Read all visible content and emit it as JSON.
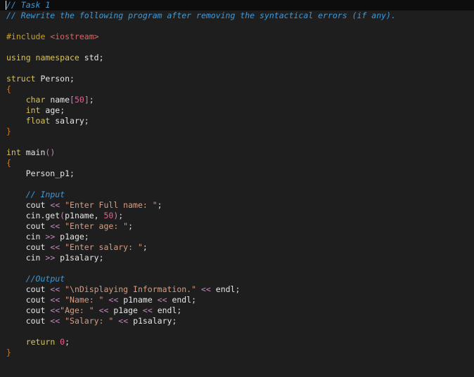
{
  "colors": {
    "background": "#1e1e1e",
    "comment": "#3c9adc",
    "keyword": "#d9c45a",
    "string": "#d69d85",
    "number": "#e65f8f",
    "operator": "#c586c0",
    "brace": "#c57b2f"
  },
  "lines": [
    {
      "tokens": [
        {
          "t": "comment",
          "v": "// Task 1"
        }
      ]
    },
    {
      "tokens": [
        {
          "t": "comment",
          "v": "// Rewrite the following program after removing the syntactical errors (if any)."
        }
      ]
    },
    {
      "tokens": []
    },
    {
      "tokens": [
        {
          "t": "directive",
          "v": "#include "
        },
        {
          "t": "header",
          "v": "<iostream>"
        }
      ]
    },
    {
      "tokens": []
    },
    {
      "tokens": [
        {
          "t": "kw",
          "v": "using namespace "
        },
        {
          "t": "txt",
          "v": "std"
        },
        {
          "t": "punc",
          "v": ";"
        }
      ]
    },
    {
      "tokens": []
    },
    {
      "tokens": [
        {
          "t": "kw",
          "v": "struct "
        },
        {
          "t": "txt",
          "v": "Person"
        },
        {
          "t": "punc",
          "v": ";"
        }
      ]
    },
    {
      "tokens": [
        {
          "t": "brace",
          "v": "{"
        }
      ]
    },
    {
      "tokens": [
        {
          "t": "txt",
          "v": "    "
        },
        {
          "t": "type",
          "v": "char "
        },
        {
          "t": "txt",
          "v": "name"
        },
        {
          "t": "bracket",
          "v": "["
        },
        {
          "t": "num",
          "v": "50"
        },
        {
          "t": "bracket",
          "v": "]"
        },
        {
          "t": "punc",
          "v": ";"
        }
      ]
    },
    {
      "tokens": [
        {
          "t": "txt",
          "v": "    "
        },
        {
          "t": "type",
          "v": "int "
        },
        {
          "t": "txt",
          "v": "age"
        },
        {
          "t": "punc",
          "v": ";"
        }
      ]
    },
    {
      "tokens": [
        {
          "t": "txt",
          "v": "    "
        },
        {
          "t": "type",
          "v": "float "
        },
        {
          "t": "txt",
          "v": "salary"
        },
        {
          "t": "punc",
          "v": ";"
        }
      ]
    },
    {
      "tokens": [
        {
          "t": "brace",
          "v": "}"
        }
      ]
    },
    {
      "tokens": []
    },
    {
      "tokens": [
        {
          "t": "type",
          "v": "int "
        },
        {
          "t": "txt",
          "v": "main"
        },
        {
          "t": "paren",
          "v": "()"
        }
      ]
    },
    {
      "tokens": [
        {
          "t": "brace",
          "v": "{"
        }
      ]
    },
    {
      "tokens": [
        {
          "t": "txt",
          "v": "    Person_p1"
        },
        {
          "t": "punc",
          "v": ";"
        }
      ]
    },
    {
      "tokens": []
    },
    {
      "tokens": [
        {
          "t": "txt",
          "v": "    "
        },
        {
          "t": "comment",
          "v": "// Input"
        }
      ]
    },
    {
      "tokens": [
        {
          "t": "txt",
          "v": "    cout "
        },
        {
          "t": "op",
          "v": "<<"
        },
        {
          "t": "str",
          "v": " \"Enter Full name: \""
        },
        {
          "t": "punc",
          "v": ";"
        }
      ]
    },
    {
      "tokens": [
        {
          "t": "txt",
          "v": "    cin.get"
        },
        {
          "t": "paren",
          "v": "("
        },
        {
          "t": "txt",
          "v": "p1name, "
        },
        {
          "t": "num",
          "v": "50"
        },
        {
          "t": "paren",
          "v": ")"
        },
        {
          "t": "punc",
          "v": ";"
        }
      ]
    },
    {
      "tokens": [
        {
          "t": "txt",
          "v": "    cout "
        },
        {
          "t": "op",
          "v": "<<"
        },
        {
          "t": "str",
          "v": " \"Enter age: \""
        },
        {
          "t": "punc",
          "v": ";"
        }
      ]
    },
    {
      "tokens": [
        {
          "t": "txt",
          "v": "    cin "
        },
        {
          "t": "op",
          "v": ">>"
        },
        {
          "t": "txt",
          "v": " p1age"
        },
        {
          "t": "punc",
          "v": ";"
        }
      ]
    },
    {
      "tokens": [
        {
          "t": "txt",
          "v": "    cout "
        },
        {
          "t": "op",
          "v": "<<"
        },
        {
          "t": "str",
          "v": " \"Enter salary: \""
        },
        {
          "t": "punc",
          "v": ";"
        }
      ]
    },
    {
      "tokens": [
        {
          "t": "txt",
          "v": "    cin "
        },
        {
          "t": "op",
          "v": ">>"
        },
        {
          "t": "txt",
          "v": " p1salary"
        },
        {
          "t": "punc",
          "v": ";"
        }
      ]
    },
    {
      "tokens": []
    },
    {
      "tokens": [
        {
          "t": "txt",
          "v": "    "
        },
        {
          "t": "comment",
          "v": "//Output"
        }
      ]
    },
    {
      "tokens": [
        {
          "t": "txt",
          "v": "    cout "
        },
        {
          "t": "op",
          "v": "<<"
        },
        {
          "t": "str",
          "v": " \"\\nDisplaying Information.\""
        },
        {
          "t": "txt",
          "v": " "
        },
        {
          "t": "op",
          "v": "<<"
        },
        {
          "t": "txt",
          "v": " endl"
        },
        {
          "t": "punc",
          "v": ";"
        }
      ]
    },
    {
      "tokens": [
        {
          "t": "txt",
          "v": "    cout "
        },
        {
          "t": "op",
          "v": "<<"
        },
        {
          "t": "str",
          "v": " \"Name: \""
        },
        {
          "t": "txt",
          "v": " "
        },
        {
          "t": "op",
          "v": "<<"
        },
        {
          "t": "txt",
          "v": " p1name "
        },
        {
          "t": "op",
          "v": "<<"
        },
        {
          "t": "txt",
          "v": " endl"
        },
        {
          "t": "punc",
          "v": ";"
        }
      ]
    },
    {
      "tokens": [
        {
          "t": "txt",
          "v": "    cout "
        },
        {
          "t": "op",
          "v": "<<"
        },
        {
          "t": "str",
          "v": "\"Age: \""
        },
        {
          "t": "txt",
          "v": " "
        },
        {
          "t": "op",
          "v": "<<"
        },
        {
          "t": "txt",
          "v": " p1age "
        },
        {
          "t": "op",
          "v": "<<"
        },
        {
          "t": "txt",
          "v": " endl"
        },
        {
          "t": "punc",
          "v": ";"
        }
      ]
    },
    {
      "tokens": [
        {
          "t": "txt",
          "v": "    cout "
        },
        {
          "t": "op",
          "v": "<<"
        },
        {
          "t": "str",
          "v": " \"Salary: \""
        },
        {
          "t": "txt",
          "v": " "
        },
        {
          "t": "op",
          "v": "<<"
        },
        {
          "t": "txt",
          "v": " p1salary"
        },
        {
          "t": "punc",
          "v": ";"
        }
      ]
    },
    {
      "tokens": []
    },
    {
      "tokens": [
        {
          "t": "txt",
          "v": "    "
        },
        {
          "t": "kw",
          "v": "return "
        },
        {
          "t": "num",
          "v": "0"
        },
        {
          "t": "punc",
          "v": ";"
        }
      ]
    },
    {
      "tokens": [
        {
          "t": "brace",
          "v": "}"
        }
      ]
    }
  ]
}
